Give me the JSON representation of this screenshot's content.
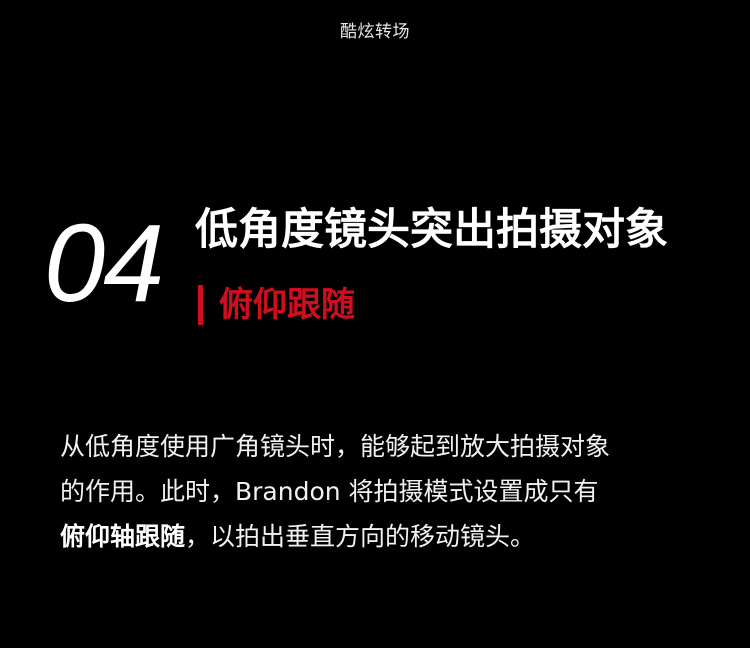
{
  "header": {
    "label": "酷炫转场"
  },
  "section": {
    "number": "04",
    "title": "低角度镜头突出拍摄对象",
    "subtitle": "俯仰跟随",
    "accent_color": "#d10e1e"
  },
  "body": {
    "line1": "从低角度使用广角镜头时，能够起到放大拍摄对象",
    "line2": "的作用。此时，Brandon 将拍摄模式设置成只有",
    "line3_bold": "俯仰轴跟随",
    "line3_rest": "，以拍出垂直方向的移动镜头。"
  }
}
